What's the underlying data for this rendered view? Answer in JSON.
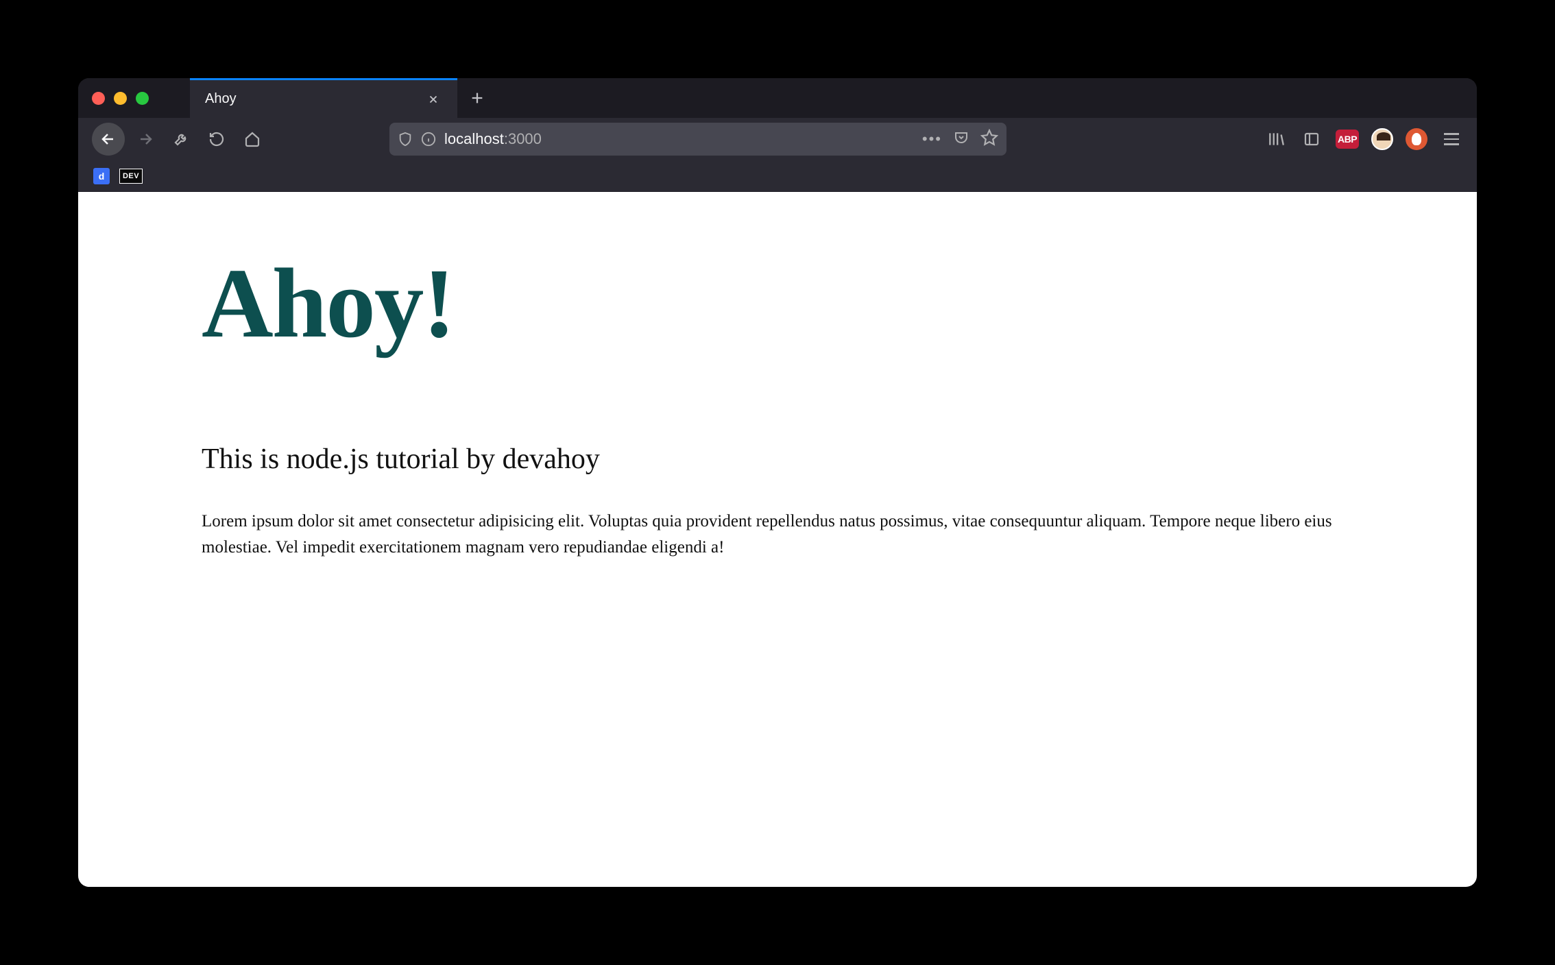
{
  "tab": {
    "title": "Ahoy"
  },
  "url": {
    "host": "localhost",
    "port": ":3000"
  },
  "bookmarks": {
    "item1_label": "d",
    "item2_label": "DEV"
  },
  "toolbar": {
    "abp_label": "ABP"
  },
  "page": {
    "heading": "Ahoy!",
    "subheading": "This is node.js tutorial by devahoy",
    "body": "Lorem ipsum dolor sit amet consectetur adipisicing elit. Voluptas quia provident repellendus natus possimus, vitae consequuntur aliquam. Tempore neque libero eius molestiae. Vel impedit exercitationem magnam vero repudiandae eligendi a!"
  }
}
